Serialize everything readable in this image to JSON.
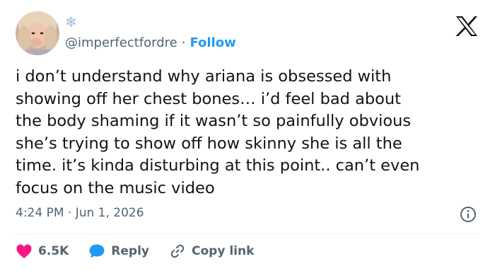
{
  "tweet": {
    "handle": "@imperfectfordre",
    "separator": "·",
    "follow_label": "Follow",
    "badge_icon": "snowflake-icon",
    "text": "i don’t understand why ariana is obsessed with\nshowing off her chest bones… i’d feel bad about\nthe body shaming if it wasn’t so painfully obvious\nshe’s trying to show off how skinny she is all the\ntime. it’s kinda disturbing at this point.. can’t even\nfocus on the music video",
    "timestamp": "4:24 PM · Jun 1, 2026"
  },
  "actions": {
    "like_count": "6.5K",
    "reply_label": "Reply",
    "copy_link_label": "Copy link"
  },
  "colors": {
    "accent": "#1d9bf0",
    "like": "#f91880",
    "muted": "#536471",
    "text": "#0f1419"
  }
}
